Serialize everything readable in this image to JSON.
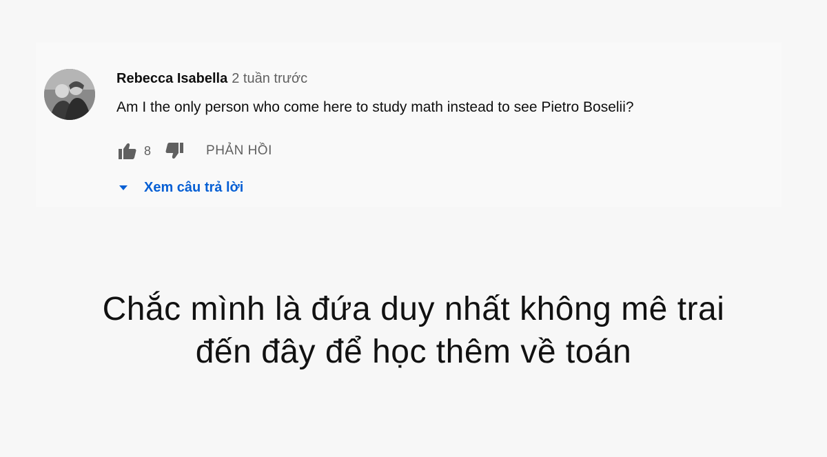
{
  "comment": {
    "author": "Rebecca Isabella",
    "timestamp": "2 tuần trước",
    "text": "Am I the only person who come here to study math instead to see Pietro Boselii?",
    "like_count": "8",
    "reply_label": "PHẢN HỒI",
    "view_replies_label": "Xem câu trả lời",
    "accent_color": "#065fd4",
    "icons": {
      "like": "thumbs-up-icon",
      "dislike": "thumbs-down-icon",
      "expand": "caret-down-icon"
    }
  },
  "caption": {
    "line1": "Chắc mình là đứa duy nhất không mê trai",
    "line2": "đến đây để học thêm về toán"
  }
}
